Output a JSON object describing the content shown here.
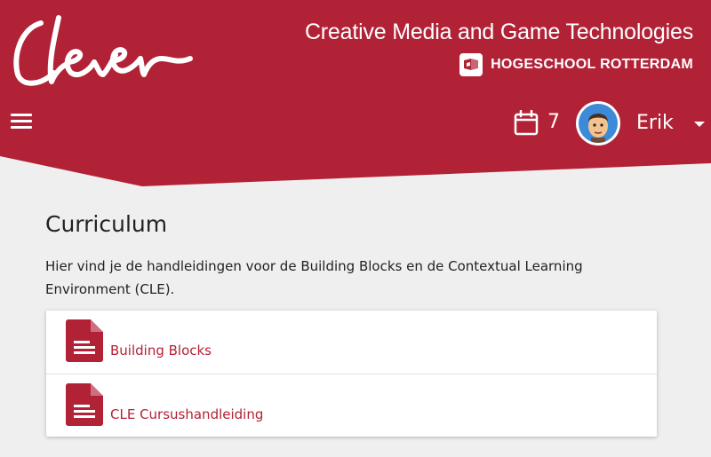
{
  "brand": {
    "logo_text": "Clever",
    "primary_color": "#b22236"
  },
  "header": {
    "program": "Creative Media and Game Technologies",
    "institution": "HOGESCHOOL ROTTERDAM",
    "calendar_count": "7",
    "user_name": "Erik"
  },
  "main": {
    "title": "Curriculum",
    "intro": "Hier vind je de handleidingen voor de Building Blocks en de Contextual Learning Environment (CLE).",
    "documents": [
      {
        "label": "Building Blocks",
        "icon": "document-icon"
      },
      {
        "label": "CLE Cursushandleiding",
        "icon": "document-icon"
      }
    ]
  }
}
